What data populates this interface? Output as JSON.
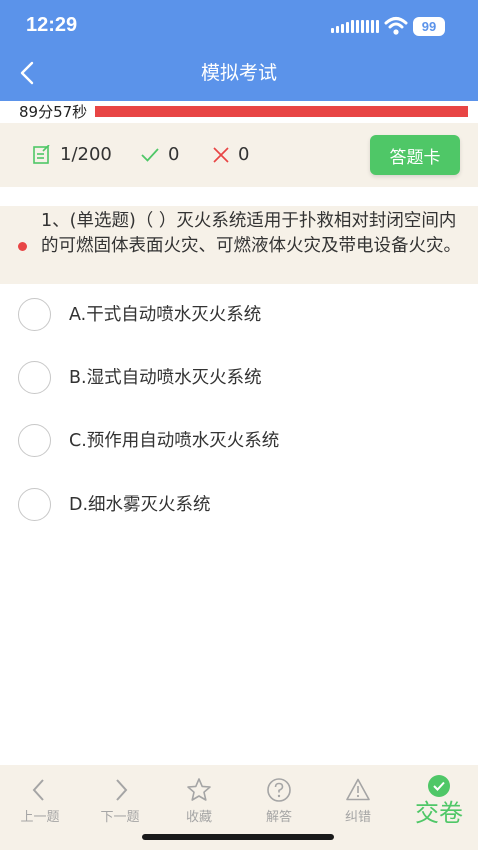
{
  "status_bar": {
    "time": "12:29",
    "battery": "99"
  },
  "header": {
    "title": "模拟考试"
  },
  "timer": {
    "text": "89分57秒",
    "remaining_fraction": 1.0
  },
  "stats": {
    "progress": "1/200",
    "correct": "0",
    "wrong": "0",
    "answer_card_label": "答题卡"
  },
  "question": {
    "text": "1、(单选题)（ ）灭火系统适用于扑救相对封闭空间内的可燃固体表面火灾、可燃液体火灾及带电设备火灾。",
    "options": [
      "A.干式自动喷水灭火系统",
      "B.湿式自动喷水灭火系统",
      "C.预作用自动喷水灭火系统",
      "D.细水雾灭火系统"
    ]
  },
  "bottom_nav": {
    "items": [
      {
        "label": "上一题",
        "icon": "chevron-left-icon"
      },
      {
        "label": "下一题",
        "icon": "chevron-right-icon"
      },
      {
        "label": "收藏",
        "icon": "star-icon"
      },
      {
        "label": "解答",
        "icon": "question-circle-icon"
      },
      {
        "label": "纠错",
        "icon": "warning-triangle-icon"
      }
    ],
    "submit_label": "交卷"
  },
  "colors": {
    "header": "#5b93ea",
    "accent_green": "#4fc767",
    "timer_bar": "#e84545",
    "panel": "#f6f1e8"
  }
}
